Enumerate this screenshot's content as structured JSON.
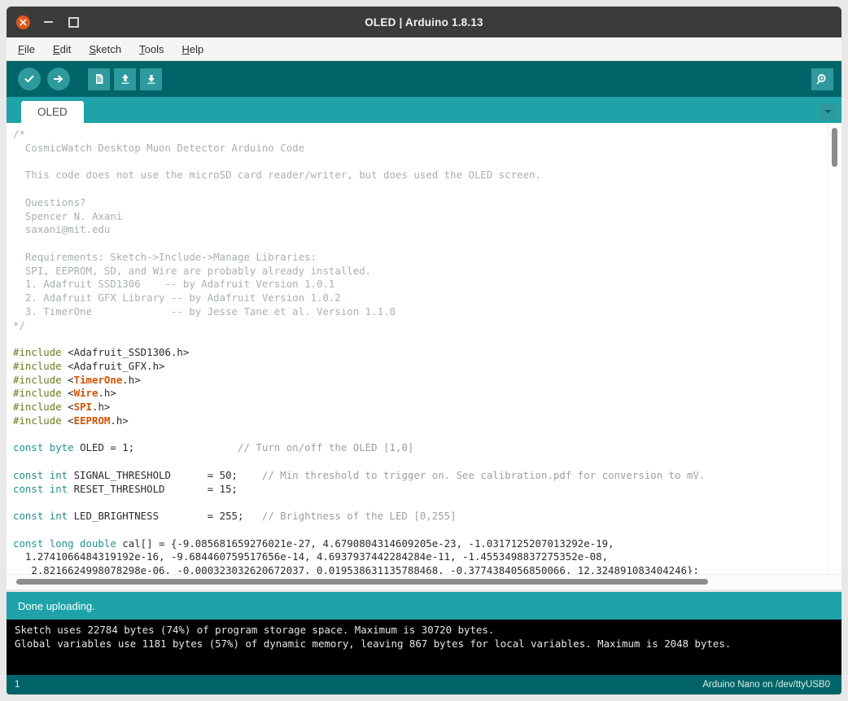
{
  "window": {
    "title": "OLED | Arduino 1.8.13",
    "close_label": "close-window",
    "minimize_label": "minimize-window",
    "maximize_label": "maximize-window"
  },
  "menubar": {
    "items": [
      {
        "mnemonic": "F",
        "rest": "ile"
      },
      {
        "mnemonic": "E",
        "rest": "dit"
      },
      {
        "mnemonic": "S",
        "rest": "ketch"
      },
      {
        "mnemonic": "T",
        "rest": "ools"
      },
      {
        "mnemonic": "H",
        "rest": "elp"
      }
    ]
  },
  "toolbar": {
    "verify": "verify-icon",
    "upload": "upload-icon",
    "new": "new-icon",
    "open": "open-icon",
    "save": "save-icon",
    "serial_monitor": "serial-monitor-icon"
  },
  "tabbar": {
    "tabs": [
      {
        "label": "OLED"
      }
    ],
    "menu_icon": "chevron-down-icon"
  },
  "editor": {
    "lines": [
      {
        "segs": [
          {
            "c": "cm",
            "t": "/*"
          }
        ]
      },
      {
        "segs": [
          {
            "c": "cm",
            "t": "  CosmicWatch Desktop Muon Detector Arduino Code"
          }
        ]
      },
      {
        "segs": [
          {
            "c": "cm",
            "t": ""
          }
        ]
      },
      {
        "segs": [
          {
            "c": "cm",
            "t": "  This code does not use the microSD card reader/writer, but does used the OLED screen."
          }
        ]
      },
      {
        "segs": [
          {
            "c": "cm",
            "t": ""
          }
        ]
      },
      {
        "segs": [
          {
            "c": "cm",
            "t": "  Questions?"
          }
        ]
      },
      {
        "segs": [
          {
            "c": "cm",
            "t": "  Spencer N. Axani"
          }
        ]
      },
      {
        "segs": [
          {
            "c": "cm",
            "t": "  saxani@mit.edu"
          }
        ]
      },
      {
        "segs": [
          {
            "c": "cm",
            "t": ""
          }
        ]
      },
      {
        "segs": [
          {
            "c": "cm",
            "t": "  Requirements: Sketch->Include->Manage Libraries:"
          }
        ]
      },
      {
        "segs": [
          {
            "c": "cm",
            "t": "  SPI, EEPROM, SD, and Wire are probably already installed."
          }
        ]
      },
      {
        "segs": [
          {
            "c": "cm",
            "t": "  1. Adafruit SSD1306    -- by Adafruit Version 1.0.1"
          }
        ]
      },
      {
        "segs": [
          {
            "c": "cm",
            "t": "  2. Adafruit GFX Library -- by Adafruit Version 1.0.2"
          }
        ]
      },
      {
        "segs": [
          {
            "c": "cm",
            "t": "  3. TimerOne             -- by Jesse Tane et al. Version 1.1.0"
          }
        ]
      },
      {
        "segs": [
          {
            "c": "cm",
            "t": "*/"
          }
        ]
      },
      {
        "segs": [
          {
            "c": "plain",
            "t": ""
          }
        ]
      },
      {
        "segs": [
          {
            "c": "pre",
            "t": "#include"
          },
          {
            "c": "plain",
            "t": " <Adafruit_SSD1306.h>"
          }
        ]
      },
      {
        "segs": [
          {
            "c": "pre",
            "t": "#include"
          },
          {
            "c": "plain",
            "t": " <Adafruit_GFX.h>"
          }
        ]
      },
      {
        "segs": [
          {
            "c": "pre",
            "t": "#include"
          },
          {
            "c": "plain",
            "t": " <"
          },
          {
            "c": "lib",
            "t": "TimerOne"
          },
          {
            "c": "plain",
            "t": ".h>"
          }
        ]
      },
      {
        "segs": [
          {
            "c": "pre",
            "t": "#include"
          },
          {
            "c": "plain",
            "t": " <"
          },
          {
            "c": "lib",
            "t": "Wire"
          },
          {
            "c": "plain",
            "t": ".h>"
          }
        ]
      },
      {
        "segs": [
          {
            "c": "pre",
            "t": "#include"
          },
          {
            "c": "plain",
            "t": " <"
          },
          {
            "c": "lib",
            "t": "SPI"
          },
          {
            "c": "plain",
            "t": ".h>"
          }
        ]
      },
      {
        "segs": [
          {
            "c": "pre",
            "t": "#include"
          },
          {
            "c": "plain",
            "t": " <"
          },
          {
            "c": "lib",
            "t": "EEPROM"
          },
          {
            "c": "plain",
            "t": ".h>"
          }
        ]
      },
      {
        "segs": [
          {
            "c": "plain",
            "t": ""
          }
        ]
      },
      {
        "segs": [
          {
            "c": "kw",
            "t": "const byte"
          },
          {
            "c": "plain",
            "t": " OLED = 1;                 "
          },
          {
            "c": "cm2",
            "t": "// Turn on/off the OLED [1,0]"
          }
        ]
      },
      {
        "segs": [
          {
            "c": "plain",
            "t": ""
          }
        ]
      },
      {
        "segs": [
          {
            "c": "kw",
            "t": "const int"
          },
          {
            "c": "plain",
            "t": " SIGNAL_THRESHOLD      = 50;    "
          },
          {
            "c": "cm2",
            "t": "// Min threshold to trigger on. See calibration.pdf for conversion to mV."
          }
        ]
      },
      {
        "segs": [
          {
            "c": "kw",
            "t": "const int"
          },
          {
            "c": "plain",
            "t": " RESET_THRESHOLD       = 15;"
          }
        ]
      },
      {
        "segs": [
          {
            "c": "plain",
            "t": ""
          }
        ]
      },
      {
        "segs": [
          {
            "c": "kw",
            "t": "const int"
          },
          {
            "c": "plain",
            "t": " LED_BRIGHTNESS        = 255;   "
          },
          {
            "c": "cm2",
            "t": "// Brightness of the LED [0,255]"
          }
        ]
      },
      {
        "segs": [
          {
            "c": "plain",
            "t": ""
          }
        ]
      },
      {
        "segs": [
          {
            "c": "kw",
            "t": "const long double"
          },
          {
            "c": "plain",
            "t": " cal[] = {-9.085681659276021e-27, 4.6790804314609205e-23, -1.0317125207013292e-19,"
          }
        ]
      },
      {
        "segs": [
          {
            "c": "plain",
            "t": "  1.2741066484319192e-16, -9.684460759517656e-14, 4.6937937442284284e-11, -1.4553498837275352e-08,"
          }
        ]
      },
      {
        "segs": [
          {
            "c": "plain",
            "t": "   2.8216624998078298e-06, -0.000323032620672037, 0.019538631135788468, -0.3774384056850066, 12.324891083404246};"
          }
        ]
      }
    ]
  },
  "status": {
    "message": "Done uploading."
  },
  "console": {
    "lines": [
      "Sketch uses 22784 bytes (74%) of program storage space. Maximum is 30720 bytes.",
      "Global variables use 1181 bytes (57%) of dynamic memory, leaving 867 bytes for local variables. Maximum is 2048 bytes."
    ]
  },
  "bottombar": {
    "line_number": "1",
    "board_info": "Arduino Nano on /dev/ttyUSB0"
  }
}
